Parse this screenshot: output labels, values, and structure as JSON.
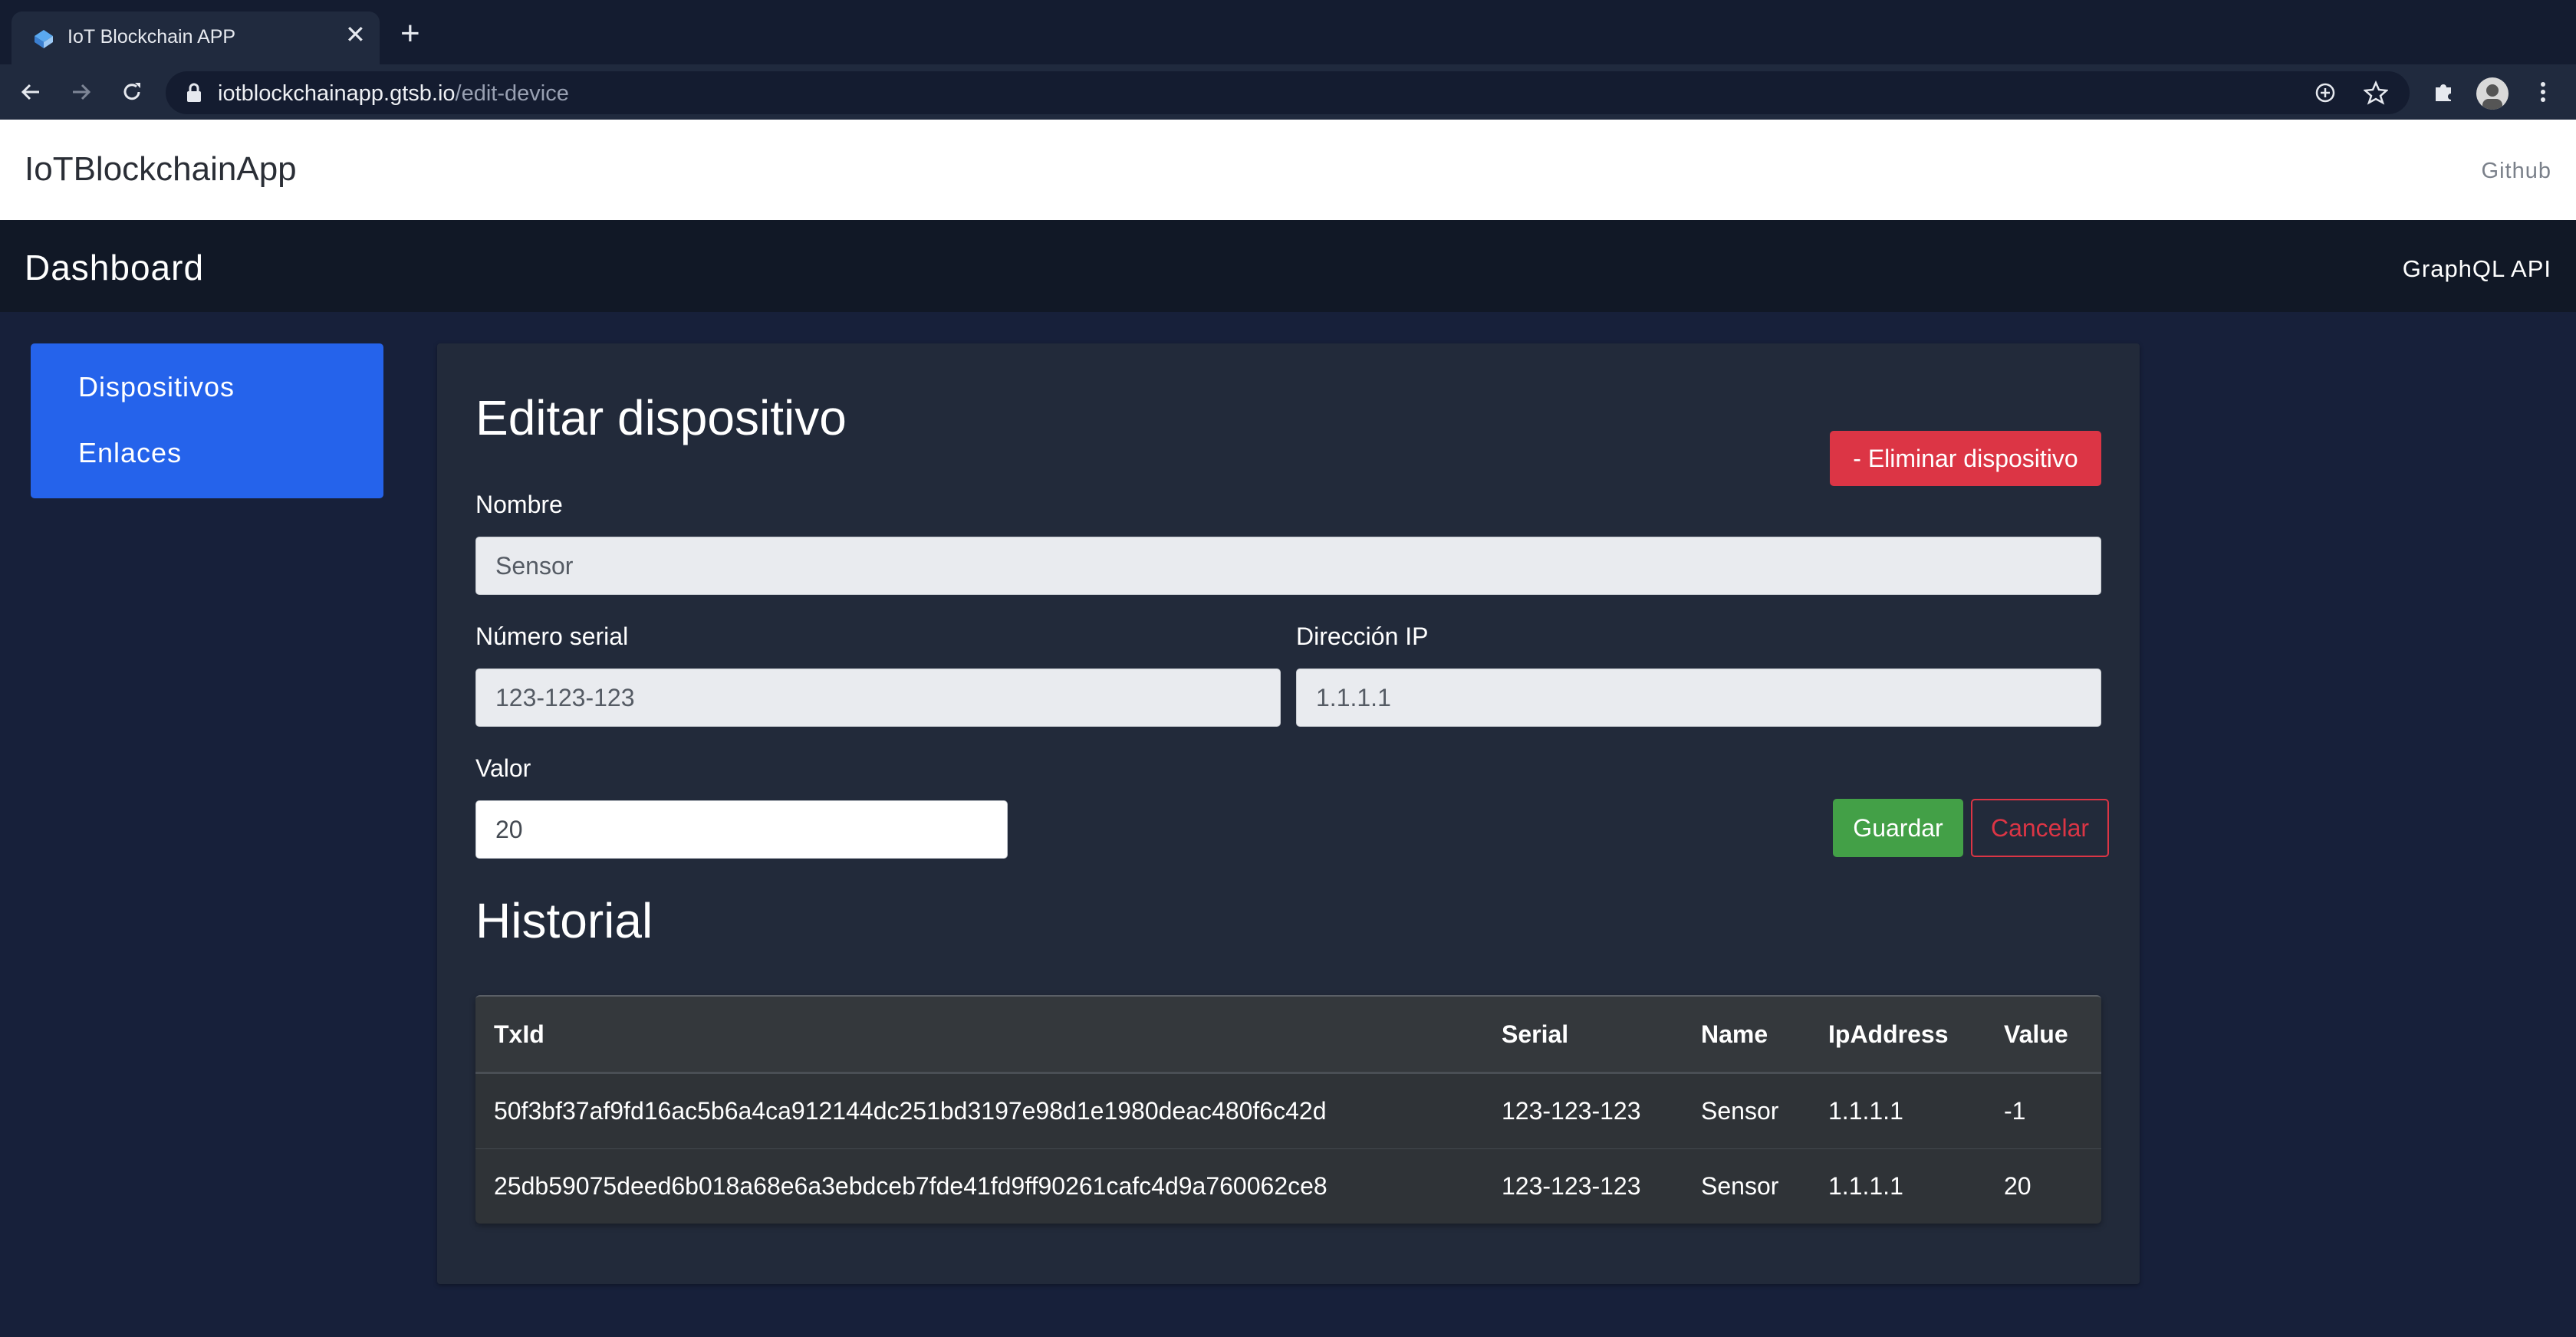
{
  "browser": {
    "tab_title": "IoT Blockchain APP",
    "url_host": "iotblockchainapp.gtsb.io",
    "url_path": "/edit-device"
  },
  "header": {
    "brand": "IoTBlockchainApp",
    "github_link": "Github"
  },
  "dashbar": {
    "title": "Dashboard",
    "api_link": "GraphQL API"
  },
  "sidebar": {
    "items": [
      {
        "label": "Dispositivos"
      },
      {
        "label": "Enlaces"
      }
    ]
  },
  "form": {
    "title": "Editar dispositivo",
    "delete_button": "- Eliminar dispositivo",
    "name_label": "Nombre",
    "name_value": "Sensor",
    "serial_label": "Número serial",
    "serial_value": "123-123-123",
    "ip_label": "Dirección IP",
    "ip_value": "1.1.1.1",
    "value_label": "Valor",
    "value_value": "20",
    "save_button": "Guardar",
    "cancel_button": "Cancelar"
  },
  "history": {
    "title": "Historial",
    "columns": [
      "TxId",
      "Serial",
      "Name",
      "IpAddress",
      "Value"
    ],
    "rows": [
      [
        "50f3bf37af9fd16ac5b6a4ca912144dc251bd3197e98d1e1980deac480f6c42d",
        "123-123-123",
        "Sensor",
        "1.1.1.1",
        "-1"
      ],
      [
        "25db59075deed6b018a68e6a3ebdceb7fde41fd9ff90261cafc4d9a760062ce8",
        "123-123-123",
        "Sensor",
        "1.1.1.1",
        "20"
      ]
    ]
  },
  "colors": {
    "sidebar_bg": "#2563eb",
    "danger": "#dc3545",
    "success": "#43a047",
    "page_bg": "#17203a",
    "card_bg": "#222a3a"
  }
}
